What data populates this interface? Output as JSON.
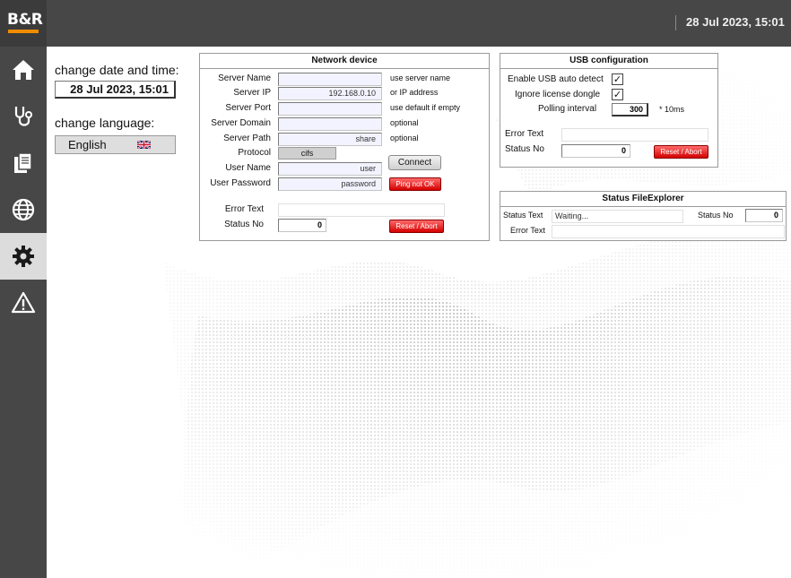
{
  "header": {
    "brand": "B&R",
    "datetime": "28 Jul 2023, 15:01"
  },
  "sidebar": {
    "items": [
      {
        "icon": "home-icon",
        "active": false
      },
      {
        "icon": "stethoscope-icon",
        "active": false
      },
      {
        "icon": "documents-icon",
        "active": false
      },
      {
        "icon": "globe-icon",
        "active": false
      },
      {
        "icon": "gear-icon",
        "active": true
      },
      {
        "icon": "warning-icon",
        "active": false
      }
    ]
  },
  "left": {
    "datetime_label": "change date and time:",
    "datetime_value": "28 Jul 2023, 15:01",
    "language_label": "change language:",
    "language_value": "English",
    "language_flag": "uk-flag-icon"
  },
  "network": {
    "title": "Network device",
    "server_name": {
      "label": "Server Name",
      "value": "",
      "hint": "use server name"
    },
    "server_ip": {
      "label": "Server IP",
      "value": "192.168.0.10",
      "hint": "or IP address"
    },
    "server_port": {
      "label": "Server Port",
      "value": "",
      "hint": "use default if empty"
    },
    "server_domain": {
      "label": "Server Domain",
      "value": "",
      "hint": "optional"
    },
    "server_path": {
      "label": "Server Path",
      "value": "share",
      "hint": "optional"
    },
    "protocol": {
      "label": "Protocol",
      "value": "cifs"
    },
    "user_name": {
      "label": "User Name",
      "value": "user"
    },
    "user_password": {
      "label": "User Password",
      "value": "password"
    },
    "connect_label": "Connect",
    "ping_label": "Ping not OK",
    "error_text_label": "Error Text",
    "error_text_value": "",
    "status_no_label": "Status No",
    "status_no_value": "0",
    "reset_label": "Reset / Abort"
  },
  "usb": {
    "title": "USB configuration",
    "auto_detect_label": "Enable USB auto detect",
    "auto_detect_checked": "✓",
    "ignore_dongle_label": "Ignore license dongle",
    "ignore_dongle_checked": "✓",
    "polling_label": "Polling interval",
    "polling_value": "300",
    "polling_unit": "* 10ms",
    "error_text_label": "Error Text",
    "error_text_value": "",
    "status_no_label": "Status No",
    "status_no_value": "0",
    "reset_label": "Reset / Abort"
  },
  "fileexplorer": {
    "title": "Status FileExplorer",
    "status_text_label": "Status Text",
    "status_text_value": "Waiting...",
    "status_no_label": "Status No",
    "status_no_value": "0",
    "error_text_label": "Error Text",
    "error_text_value": ""
  },
  "colors": {
    "sidebar": "#474747",
    "active_nav": "#dcdcdc",
    "accent_orange": "#f08c00",
    "button_red": "#e00000",
    "field_bg": "#f3f3ff"
  }
}
